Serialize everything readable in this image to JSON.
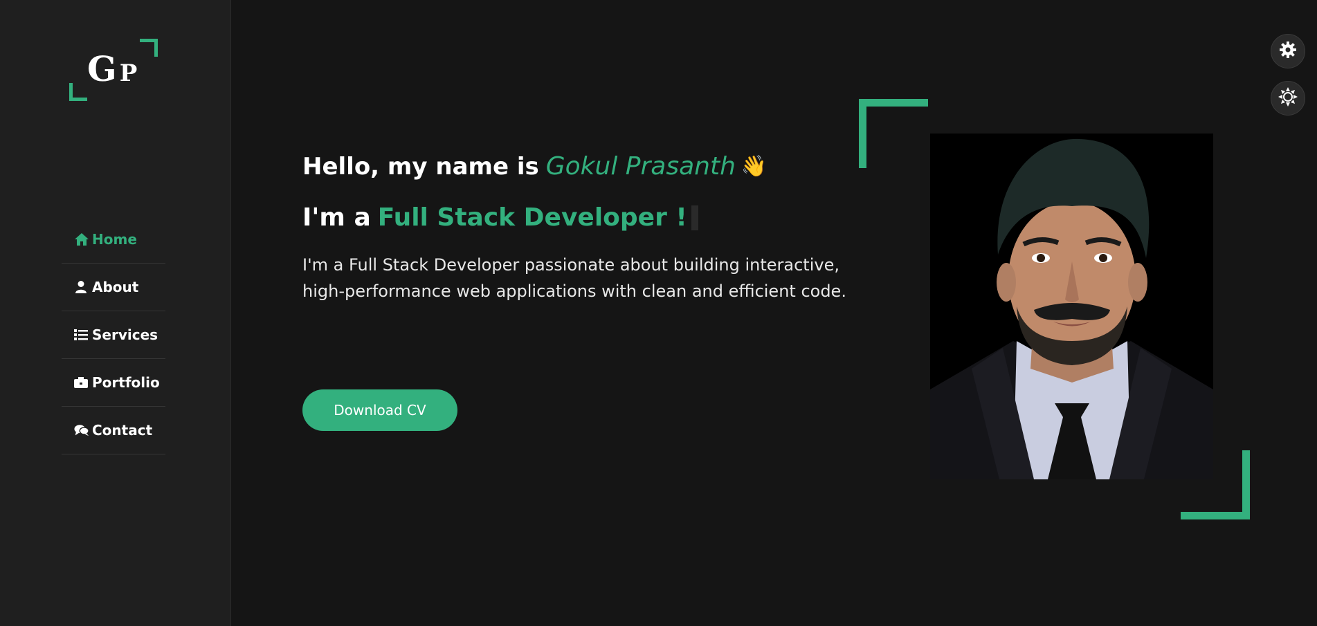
{
  "logo": {
    "letter1": "G",
    "letter2": "P"
  },
  "nav": {
    "items": [
      {
        "label": "Home",
        "icon": "home-icon",
        "active": true
      },
      {
        "label": "About",
        "icon": "user-icon",
        "active": false
      },
      {
        "label": "Services",
        "icon": "list-icon",
        "active": false
      },
      {
        "label": "Portfolio",
        "icon": "briefcase-icon",
        "active": false
      },
      {
        "label": "Contact",
        "icon": "chat-icon",
        "active": false
      }
    ]
  },
  "hero": {
    "greeting": "Hello, my name is",
    "name": "Gokul  Prasanth",
    "wave": "👋",
    "role_prefix": "I'm a",
    "role": "Full Stack Developer !",
    "description": "I'm a Full Stack Developer passionate about building interactive, high-performance web applications with clean and efficient code.",
    "cta_label": "Download CV"
  },
  "floating": {
    "settings_icon": "gear-icon",
    "theme_icon": "sun-icon"
  },
  "colors": {
    "accent": "#33b07e",
    "background": "#151515",
    "sidebar": "#1f1f1f"
  }
}
